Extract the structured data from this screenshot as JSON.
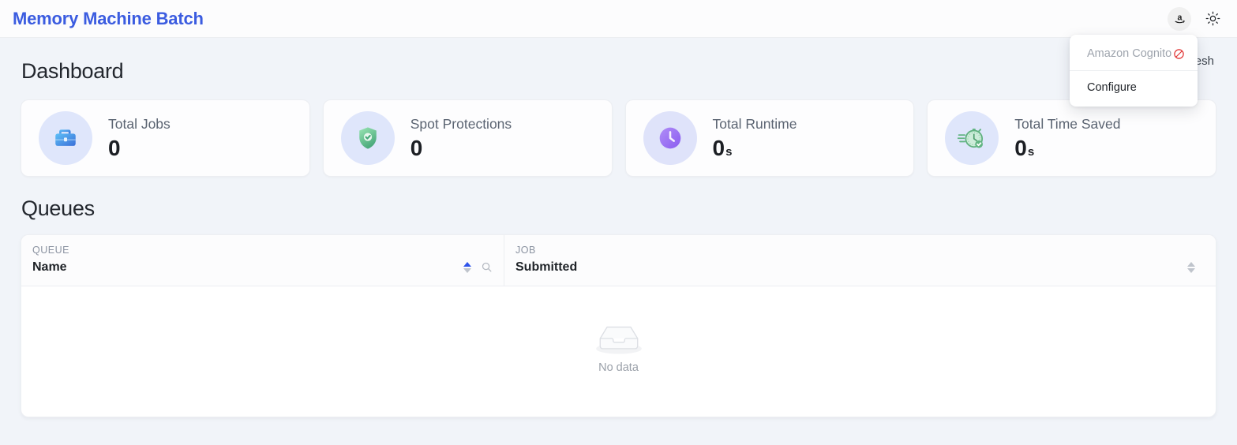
{
  "app": {
    "title": "Memory Machine Batch",
    "account_icon": "amazon-logo-icon",
    "theme_icon": "sun-icon"
  },
  "account_menu": {
    "provider_label": "Amazon Cognito",
    "provider_status_icon": "prohibition-icon",
    "configure_label": "Configure"
  },
  "dashboard": {
    "heading": "Dashboard",
    "refresh_label": "Refresh",
    "stats": [
      {
        "label": "Total Jobs",
        "value": "0",
        "unit": "",
        "icon": "briefcase-icon",
        "icon_color": "#4aa3f0"
      },
      {
        "label": "Spot Protections",
        "value": "0",
        "unit": "",
        "icon": "shield-check-icon",
        "icon_color": "#62c08c"
      },
      {
        "label": "Total Runtime",
        "value": "0",
        "unit": "s",
        "icon": "clock-icon",
        "icon_color": "#9b6ff0"
      },
      {
        "label": "Total Time Saved",
        "value": "0",
        "unit": "s",
        "icon": "stopwatch-check-icon",
        "icon_color": "#5fb882"
      }
    ]
  },
  "queues": {
    "heading": "Queues",
    "groups": [
      {
        "label": "QUEUE"
      },
      {
        "label": "JOB"
      }
    ],
    "columns": [
      {
        "label": "Name",
        "sort": "ascend",
        "searchable": true
      },
      {
        "label": "Submitted",
        "sort": "none",
        "searchable": false
      }
    ],
    "rows": [],
    "empty_text": "No data",
    "empty_icon": "empty-inbox-icon"
  },
  "theme": {
    "accent": "#3b5ce0",
    "page_bg": "#f1f4f9",
    "card_bg": "#fdfdfe",
    "sort_active": "#2f54eb",
    "danger": "#e03131"
  }
}
